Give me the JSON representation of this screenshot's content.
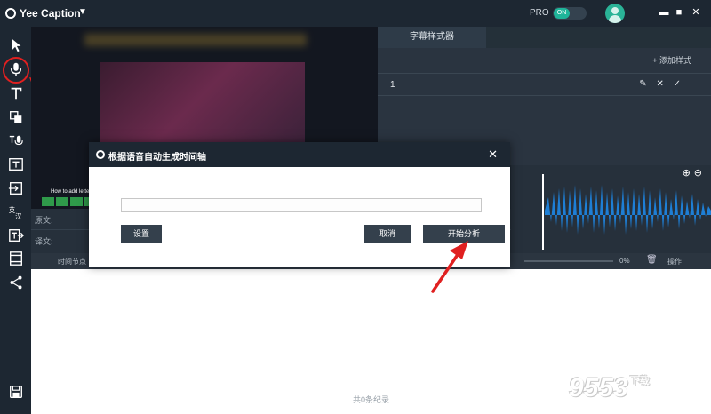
{
  "app": {
    "title": "Yee Caption",
    "pro_label": "PRO",
    "toggle_label": "ON"
  },
  "window": {
    "minimize": "▬",
    "maximize": "■",
    "close": "✕"
  },
  "style_panel": {
    "tab": "字幕样式器",
    "add_style": "+ 添加样式",
    "rows": [
      {
        "num": "1",
        "icons": "✎ ✕ ✓"
      }
    ]
  },
  "editor": {
    "source_label": "原文:",
    "translation_label": "译文:",
    "time_header": "时间节点",
    "percent": "0%",
    "operation": "操作",
    "record_count": "共0条纪录"
  },
  "video": {
    "caption": "How to add letters"
  },
  "dialog": {
    "title": "根据语音自动生成时间轴",
    "settings_label": "设置",
    "cancel_label": "取消",
    "start_label": "开始分析"
  },
  "watermark": {
    "text": "9553",
    "suffix": "下载"
  },
  "colors": {
    "accent": "#1fb59a",
    "dark": "#1d2732",
    "wave": "#1e7fd6",
    "arrow": "#e02020"
  }
}
